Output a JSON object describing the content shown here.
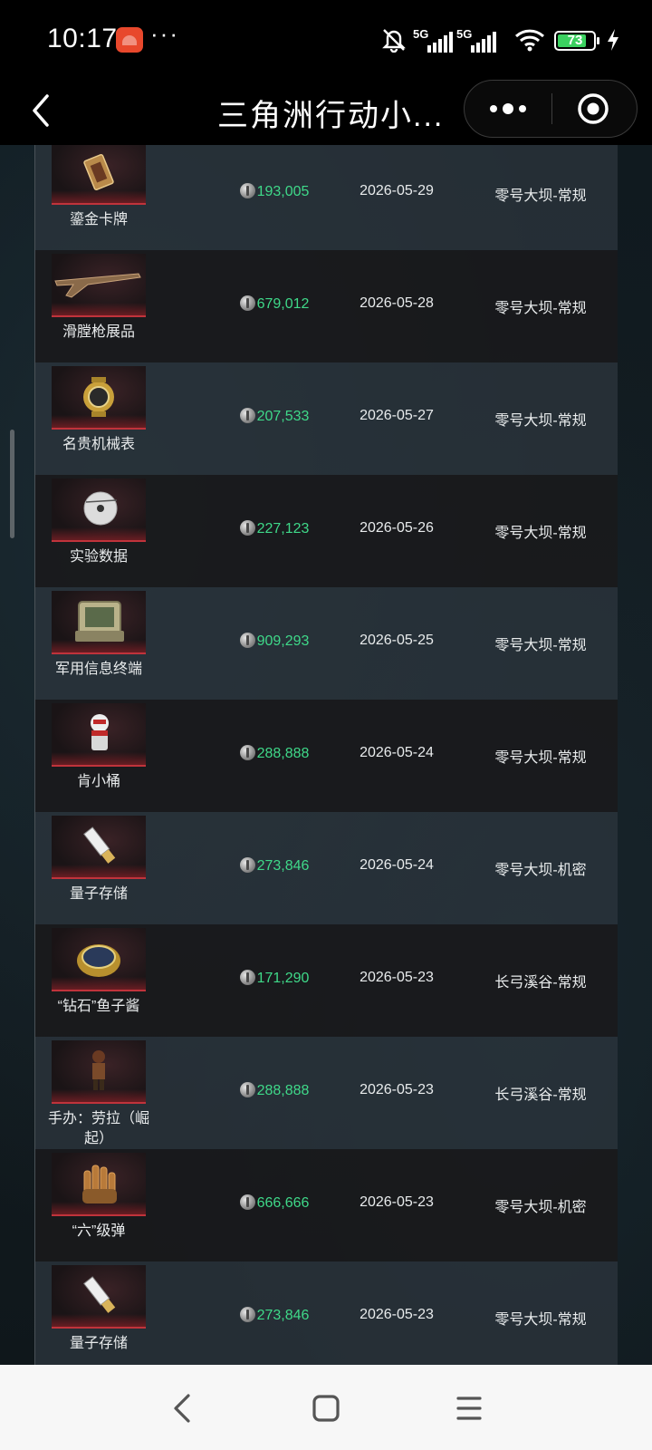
{
  "status_bar": {
    "time": "10:17",
    "dots": "···",
    "network_1": "5G",
    "network_2": "5G",
    "battery": "73",
    "icons": [
      "app-notification-icon",
      "mute-icon",
      "signal-icon",
      "wifi-icon",
      "battery-icon",
      "charging-icon"
    ]
  },
  "header": {
    "title": "三角洲行动小...",
    "icons": [
      "back-arrow-icon",
      "more-dots-icon",
      "target-close-icon"
    ]
  },
  "records": [
    {
      "name": "鎏金卡牌",
      "price": "193,005",
      "date": "2026-05-29",
      "map": "零号大坝-常规",
      "icon": "gold-card-icon"
    },
    {
      "name": "滑膛枪展品",
      "price": "679,012",
      "date": "2026-05-28",
      "map": "零号大坝-常规",
      "icon": "musket-icon"
    },
    {
      "name": "名贵机械表",
      "price": "207,533",
      "date": "2026-05-27",
      "map": "零号大坝-常规",
      "icon": "watch-icon"
    },
    {
      "name": "实验数据",
      "price": "227,123",
      "date": "2026-05-26",
      "map": "零号大坝-常规",
      "icon": "disc-icon"
    },
    {
      "name": "军用信息终端",
      "price": "909,293",
      "date": "2026-05-25",
      "map": "零号大坝-常规",
      "icon": "terminal-icon"
    },
    {
      "name": "肯小桶",
      "price": "288,888",
      "date": "2026-05-24",
      "map": "零号大坝-常规",
      "icon": "figure-icon"
    },
    {
      "name": "量子存储",
      "price": "273,846",
      "date": "2026-05-24",
      "map": "零号大坝-机密",
      "icon": "usb-drive-icon"
    },
    {
      "name": "“钻石”鱼子酱",
      "price": "171,290",
      "date": "2026-05-23",
      "map": "长弓溪谷-常规",
      "icon": "caviar-tin-icon"
    },
    {
      "name": "手办：劳拉（崛起）",
      "price": "288,888",
      "date": "2026-05-23",
      "map": "长弓溪谷-常规",
      "icon": "figurine-icon"
    },
    {
      "name": "“六”级弹",
      "price": "666,666",
      "date": "2026-05-23",
      "map": "零号大坝-机密",
      "icon": "bullets-icon"
    },
    {
      "name": "量子存储",
      "price": "273,846",
      "date": "2026-05-23",
      "map": "零号大坝-常规",
      "icon": "usb-drive-icon"
    }
  ],
  "nav": [
    "back-nav-icon",
    "home-nav-icon",
    "menu-nav-icon"
  ]
}
